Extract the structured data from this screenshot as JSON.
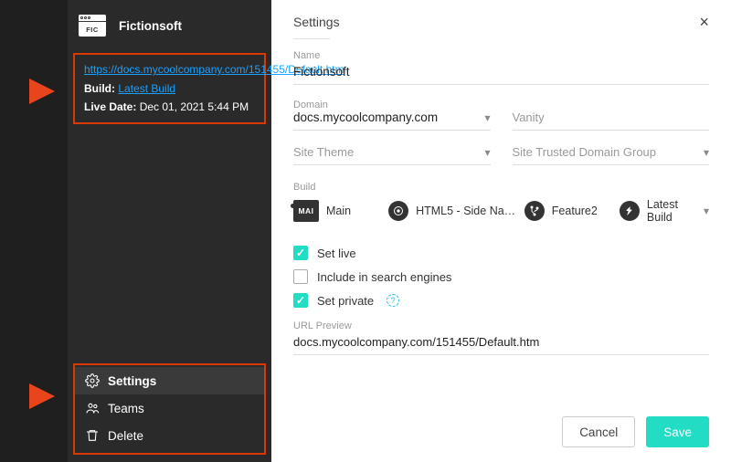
{
  "sidebar": {
    "app_icon_label": "FIC",
    "app_title": "Fictionsoft",
    "info": {
      "url": "https://docs.mycoolcompany.com/151455/Default.htm",
      "build_label": "Build:",
      "build_value": "Latest Build",
      "live_label": "Live Date:",
      "live_value": "Dec 01, 2021 5:44 PM"
    },
    "nav": {
      "settings": "Settings",
      "teams": "Teams",
      "delete": "Delete"
    }
  },
  "panel": {
    "title": "Settings",
    "name_label": "Name",
    "name_value": "Fictionsoft",
    "domain_label": "Domain",
    "domain_value": "docs.mycoolcompany.com",
    "vanity_placeholder": "Vanity",
    "site_theme_label": "Site Theme",
    "trusted_group_label": "Site Trusted Domain Group",
    "build_label": "Build",
    "build": {
      "main": "Main",
      "html5": "HTML5 - Side Navig...",
      "feature2": "Feature2",
      "latest": "Latest Build"
    },
    "checks": {
      "set_live": "Set live",
      "include_search": "Include in search engines",
      "set_private": "Set private"
    },
    "url_preview_label": "URL Preview",
    "url_preview_value": "docs.mycoolcompany.com/151455/Default.htm",
    "cancel": "Cancel",
    "save": "Save"
  }
}
